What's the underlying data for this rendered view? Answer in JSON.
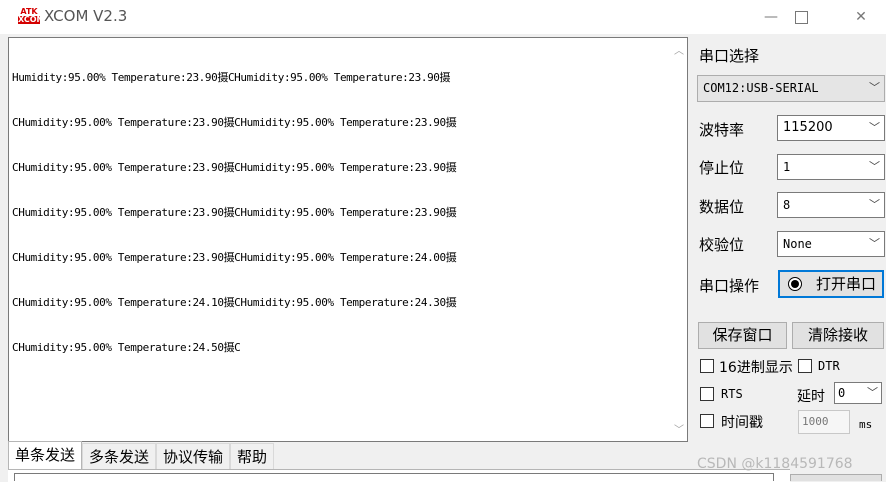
{
  "window": {
    "logo_top": "ATK",
    "logo_bottom": "XCOM",
    "title": "XCOM V2.3",
    "min_glyph": "—",
    "close_glyph": "✕"
  },
  "receive": {
    "lines": [
      "Humidity:95.00% Temperature:23.90摄CHumidity:95.00% Temperature:23.90摄",
      "CHumidity:95.00% Temperature:23.90摄CHumidity:95.00% Temperature:23.90摄",
      "CHumidity:95.00% Temperature:23.90摄CHumidity:95.00% Temperature:23.90摄",
      "CHumidity:95.00% Temperature:23.90摄CHumidity:95.00% Temperature:23.90摄",
      "CHumidity:95.00% Temperature:23.90摄CHumidity:95.00% Temperature:24.00摄",
      "CHumidity:95.00% Temperature:24.10摄CHumidity:95.00% Temperature:24.30摄",
      "CHumidity:95.00% Temperature:24.50摄C"
    ]
  },
  "serial": {
    "port_label": "串口选择",
    "port_value": "COM12:USB-SERIAL",
    "baud_label": "波特率",
    "baud_value": "115200",
    "stop_label": "停止位",
    "stop_value": "1",
    "data_label": "数据位",
    "data_value": "8",
    "parity_label": "校验位",
    "parity_value": "None",
    "operation_label": "串口操作",
    "open_button": "打开串口"
  },
  "actions": {
    "save_window": "保存窗口",
    "clear_receive": "清除接收"
  },
  "options": {
    "hex_display": "16进制显示",
    "dtr": "DTR",
    "rts": "RTS",
    "delay_label": "延时",
    "delay_value": "0",
    "timestamp": "时间戳",
    "timestamp_value": "1000",
    "ms": "ms"
  },
  "tabs": [
    "单条发送",
    "多条发送",
    "协议传输",
    "帮助"
  ],
  "watermark": "CSDN @k1184591768"
}
